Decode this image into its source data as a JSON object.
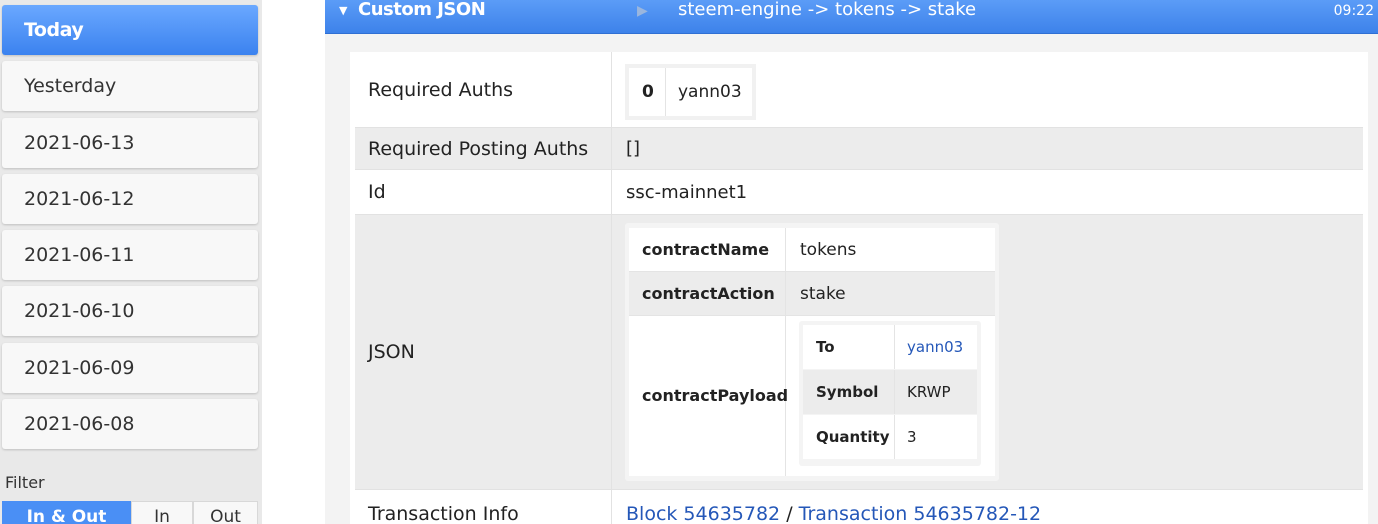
{
  "sidebar": {
    "days": [
      "Today",
      "Yesterday",
      "2021-06-13",
      "2021-06-12",
      "2021-06-11",
      "2021-06-10",
      "2021-06-09",
      "2021-06-08"
    ],
    "active_day": "Today",
    "filter_label": "Filter",
    "filters": [
      "In & Out",
      "In",
      "Out"
    ],
    "active_filter": "In & Out"
  },
  "operation": {
    "type": "Custom JSON",
    "summary": "steem-engine -> tokens -> stake",
    "time": "09:22"
  },
  "details": {
    "required_auths_label": "Required Auths",
    "required_auths_index": "0",
    "required_auths_value": "yann03",
    "required_posting_auths_label": "Required Posting Auths",
    "required_posting_auths_value": "[]",
    "id_label": "Id",
    "id_value": "ssc-mainnet1",
    "json_label": "JSON",
    "json": {
      "contract_name_label": "contractName",
      "contract_name_value": "tokens",
      "contract_action_label": "contractAction",
      "contract_action_value": "stake",
      "contract_payload_label": "contractPayload",
      "payload": {
        "to_label": "To",
        "to_value": "yann03",
        "symbol_label": "Symbol",
        "symbol_value": "KRWP",
        "quantity_label": "Quantity",
        "quantity_value": "3"
      }
    },
    "transaction_info_label": "Transaction Info",
    "block_link": "Block 54635782",
    "separator": "/",
    "transaction_link": "Transaction 54635782-12"
  },
  "colors": {
    "accent": "#3d82ea",
    "link": "#2457b8"
  },
  "icons": {
    "collapse": "caret-down-icon",
    "play": "play-icon"
  }
}
